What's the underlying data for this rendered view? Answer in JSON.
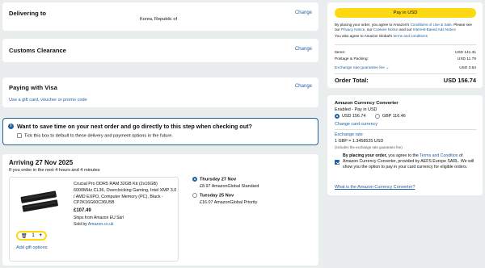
{
  "delivering": {
    "title": "Delivering to",
    "address": "Korea, Republic of",
    "change": "Change"
  },
  "customs": {
    "title": "Customs Clearance",
    "change": "Change"
  },
  "payment": {
    "title": "Paying with Visa",
    "gift_link": "Use a gift card, voucher or promo code",
    "change": "Change"
  },
  "banner": {
    "title": "Want to save time on your next order and go directly to this step when checking out?",
    "checkbox_label": "Tick this box to default to these delivery and payment options in the future."
  },
  "arrival": {
    "title": "Arriving 27 Nov 2025",
    "subtitle": "If you order in the next 4 hours and 4 minutes",
    "product": {
      "name": "Crucial Pro DDR5 RAM 32GB Kit (2x16GB) 6000MHz CL36, Overclocking Gaming, Intel XMP 3.0 / AMD EXPO, Computer Memory (PC), Black - CP2K16G60C36U5B",
      "price": "£107.49",
      "ships_from": "Ships from Amazon EU Sàrl",
      "sold_by_label": "Sold by",
      "sold_by": "Amazon.co.uk",
      "quantity": "1",
      "add_gift": "Add gift options"
    },
    "shipping_options": [
      {
        "date": "Thursday 27 Nov",
        "price_desc": "£8.97 AmazonGlobal Standard",
        "selected": true
      },
      {
        "date": "Tuesday 25 Nov",
        "price_desc": "£16.07 AmazonGlobal Priority",
        "selected": false
      }
    ]
  },
  "summary": {
    "pay_button": "Pay in USD",
    "legal1_pre": "By placing your order, you agree to Amazon's",
    "legal1_link1": "Conditions of Use & Sale",
    "legal1_mid": ". Please see our",
    "legal1_link2": "Privacy Notice",
    "legal1_mid2": ", our",
    "legal1_link3": "Cookies Notice",
    "legal1_mid3": "and our",
    "legal1_link4": "Interest-Based Ads Notice",
    "legal2_pre": "You also agree to Amazon Global's",
    "legal2_link": "terms and conditions",
    "rows": [
      {
        "label": "Items:",
        "value": "USD 141.31"
      },
      {
        "label": "Postage & Packing:",
        "value": "USD 11.79"
      }
    ],
    "fee_label": "Exchange rate guarantee fee",
    "fee_value": "USD 3.64",
    "total_label": "Order Total:",
    "total_value": "USD 156.74"
  },
  "converter": {
    "title": "Amazon Currency Converter",
    "status": "Enabled - Pay in USD",
    "option_usd": "USD 156.74",
    "option_gbp": "GBP 116.46",
    "change_link": "Change card currency",
    "rate_label": "Exchange rate",
    "rate_value": "1 GBP = 1.3458525 USD",
    "rate_note": "(includes the exchange rate guarantee fee)",
    "agree_bold": "By placing your order,",
    "agree_pre": "you agree to the",
    "agree_link": "Terms and Condition",
    "agree_rest": "of Amazon Currency Converter, provided by AEFS Europe SARL. We will show you the option to pay in your card currency for eligible orders.",
    "what_link": "What is the Amazon Currency Converter?"
  },
  "colors": {
    "accent": "#2162a1",
    "pay_button": "#ffd814",
    "banner_border": "#2162a1"
  }
}
